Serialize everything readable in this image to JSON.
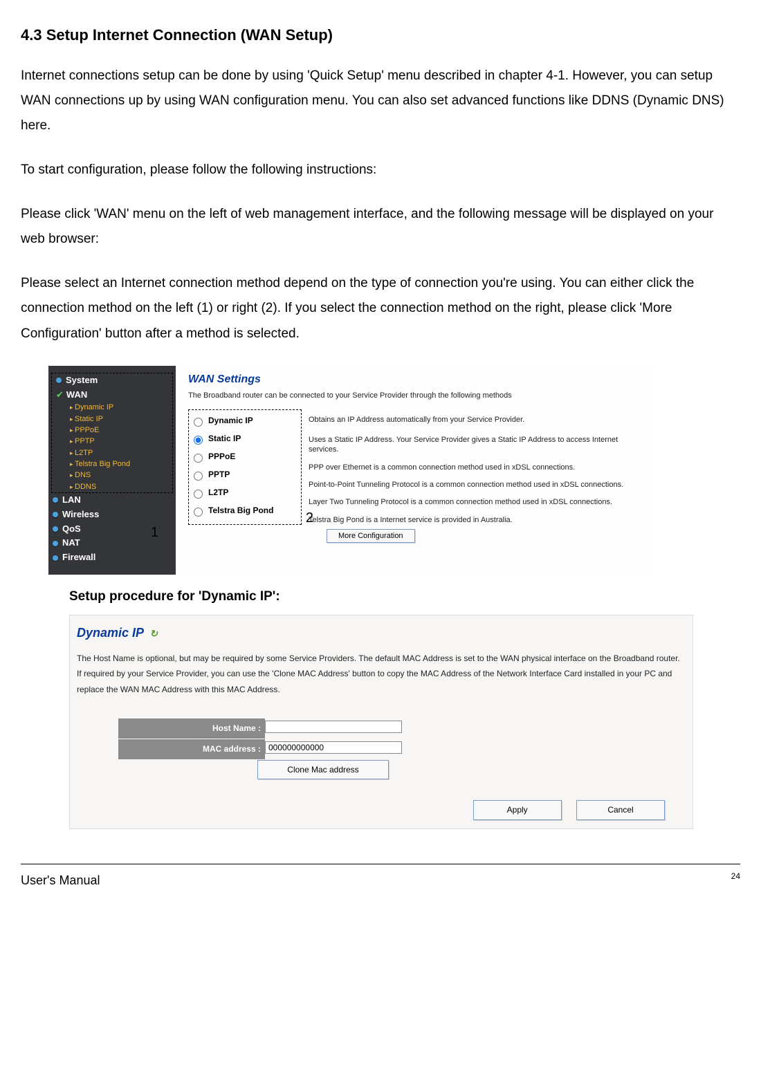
{
  "heading": "4.3 Setup Internet Connection (WAN Setup)",
  "para1": "Internet connections setup can be done by using 'Quick Setup' menu described in chapter 4-1. However, you can setup WAN connections up by using WAN configuration menu. You can also set advanced functions like DDNS (Dynamic DNS) here.",
  "para2": "To start configuration, please follow the following instructions:",
  "para3": "Please click 'WAN' menu on the left of web management interface, and the following message will be displayed on your web browser:",
  "para4": "Please select an Internet connection method depend on the type of connection you're using. You can either click the connection method on the left (1) or right (2). If you select the connection method on the right, please click 'More Configuration' button after a method is selected.",
  "sidebar": {
    "main": [
      "System",
      "WAN",
      "LAN",
      "Wireless",
      "QoS",
      "NAT",
      "Firewall"
    ],
    "sub": [
      "Dynamic IP",
      "Static IP",
      "PPPoE",
      "PPTP",
      "L2TP",
      "Telstra Big Pond",
      "DNS",
      "DDNS"
    ]
  },
  "annot1": "1",
  "annot2": "2",
  "wan": {
    "title": "WAN Settings",
    "desc": "The Broadband router can be connected to your Service Provider through the following methods",
    "options": [
      {
        "label": "Dynamic IP",
        "desc": "Obtains an IP Address automatically from your Service Provider."
      },
      {
        "label": "Static IP",
        "desc": "Uses a Static IP Address. Your Service Provider gives a Static IP Address to access Internet services."
      },
      {
        "label": "PPPoE",
        "desc": "PPP over Ethernet is a common connection method used in xDSL connections."
      },
      {
        "label": "PPTP",
        "desc": "Point-to-Point Tunneling Protocol is a common connection method used in xDSL connections."
      },
      {
        "label": "L2TP",
        "desc": "Layer Two Tunneling Protocol is a common connection method used in xDSL connections."
      },
      {
        "label": "Telstra Big Pond",
        "desc": "Telstra Big Pond is a Internet service is provided in Australia."
      }
    ],
    "selected_index": 1,
    "more_button": "More Configuration"
  },
  "subheading": "Setup procedure for 'Dynamic IP':",
  "dynip": {
    "title": "Dynamic IP",
    "desc": "The Host Name is optional, but may be required by some Service Providers. The default MAC Address is set to the WAN physical interface on the Broadband router. If required by your Service Provider, you can use the 'Clone MAC Address' button to copy the MAC Address of the Network Interface Card installed in your PC and replace the WAN MAC Address with this MAC Address.",
    "host_label": "Host Name :",
    "host_value": "",
    "mac_label": "MAC address :",
    "mac_value": "000000000000",
    "clone_button": "Clone Mac address",
    "apply_button": "Apply",
    "cancel_button": "Cancel"
  },
  "footer": {
    "left": "User's Manual",
    "page": "24"
  }
}
